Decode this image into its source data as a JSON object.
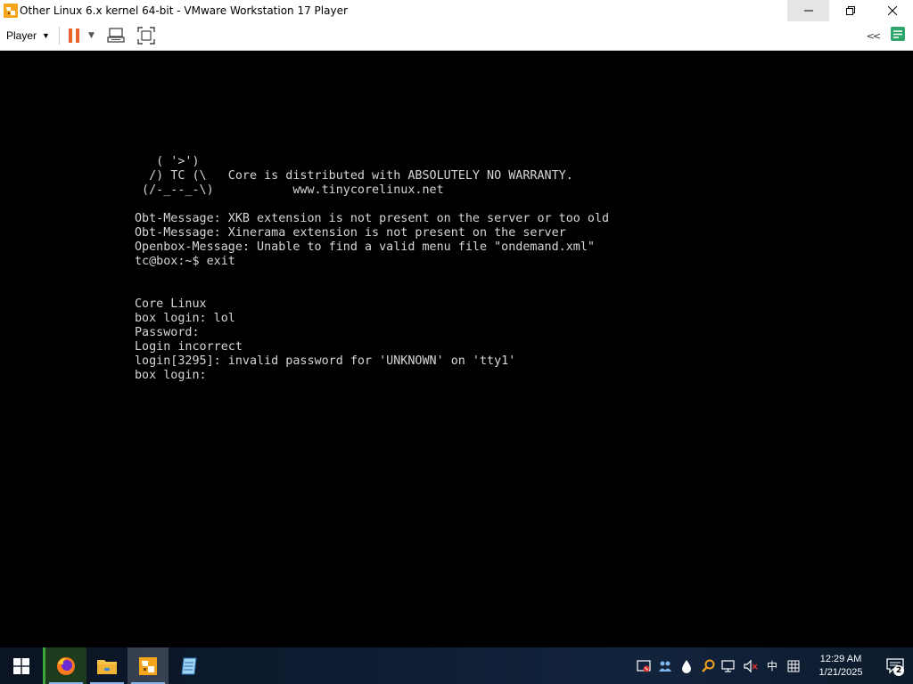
{
  "window": {
    "title": "Other Linux 6.x kernel 64-bit - VMware Workstation 17 Player",
    "minimize": "–",
    "maximize": "❐",
    "close": "✕"
  },
  "toolbar": {
    "player_label": "Player",
    "player_caret": "▼",
    "pause_caret": "▼",
    "collapse": "<<"
  },
  "console": {
    "lines": [
      "   ( '>')",
      "  /) TC (\\   Core is distributed with ABSOLUTELY NO WARRANTY.",
      " (/-_--_-\\)           www.tinycorelinux.net",
      "",
      "Obt-Message: XKB extension is not present on the server or too old",
      "Obt-Message: Xinerama extension is not present on the server",
      "Openbox-Message: Unable to find a valid menu file \"ondemand.xml\"",
      "tc@box:~$ exit",
      "",
      "",
      "Core Linux",
      "box login: lol",
      "Password:",
      "Login incorrect",
      "login[3295]: invalid password for 'UNKNOWN' on 'tty1'",
      "box login:"
    ]
  },
  "taskbar": {
    "apps": [
      {
        "name": "firefox-icon"
      },
      {
        "name": "file-explorer-icon"
      },
      {
        "name": "vmware-player-icon"
      },
      {
        "name": "notepad-icon"
      }
    ],
    "tray": {
      "ime_label": "中",
      "clock_time": "12:29 AM",
      "clock_date": "1/21/2025",
      "notification_count": "2"
    }
  },
  "colors": {
    "accent_pause": "#e8622c",
    "console_bg": "#000000",
    "console_text": "#d6d6d6",
    "vmware_orange": "#f3a51b"
  }
}
